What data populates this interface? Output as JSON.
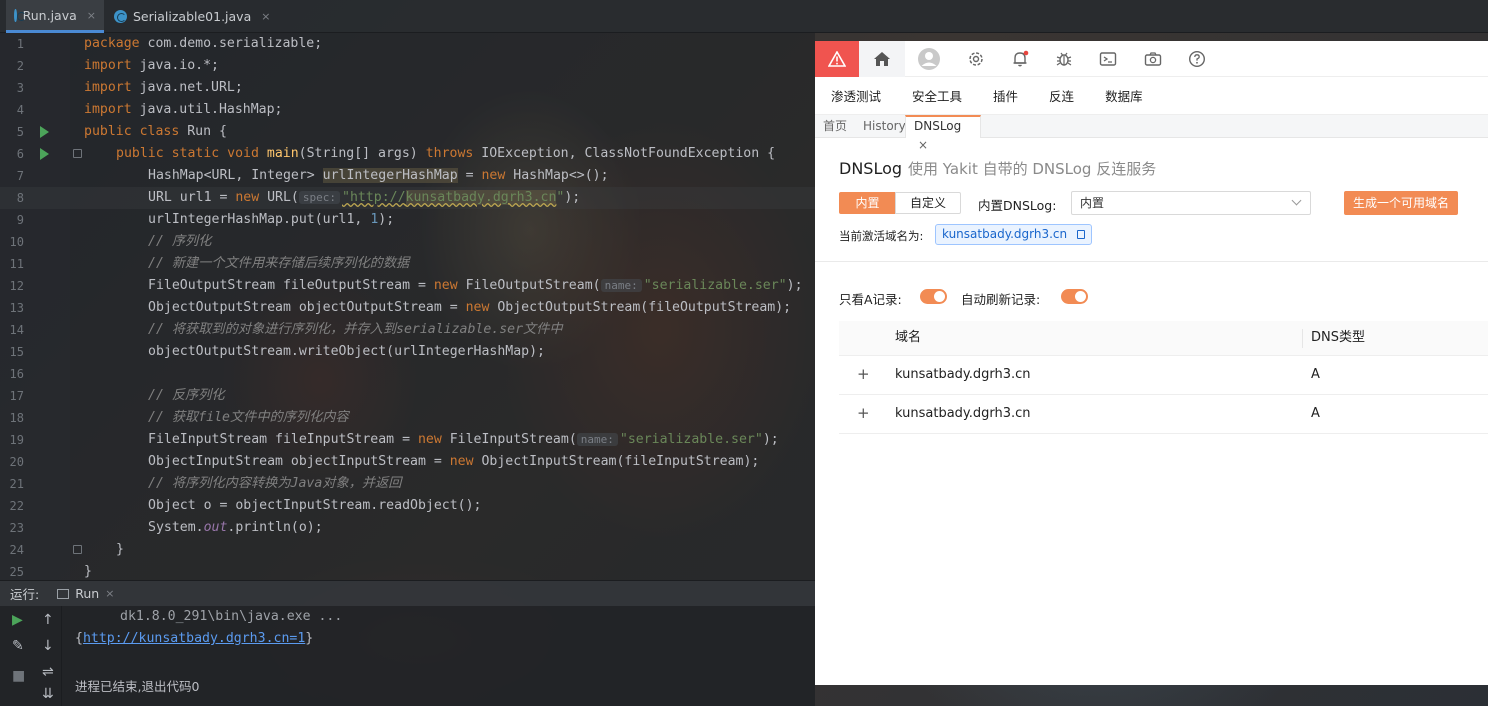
{
  "editor_tabs": [
    {
      "label": "Run.java",
      "close": "×"
    },
    {
      "label": "Serializable01.java",
      "close": "×"
    }
  ],
  "code_lines": [
    "1",
    "2",
    "3",
    "4",
    "5",
    "6",
    "7",
    "8",
    "9",
    "10",
    "11",
    "12",
    "13",
    "14",
    "15",
    "16",
    "17",
    "18",
    "19",
    "20",
    "21",
    "22",
    "23",
    "24",
    "25"
  ],
  "code": {
    "l1_kw": "package",
    "l1_rest": " com.demo.serializable;",
    "l2_kw": "import",
    "l2_rest": " java.io.*;",
    "l3_kw": "import",
    "l3_rest": " java.net.URL;",
    "l4_kw": "import",
    "l4_rest": " java.util.HashMap;",
    "l5_kw": "public class",
    "l5_rest": " Run {",
    "l6_kw": "public static void",
    "l6_fn": "main",
    "l6_a": "(String[] args) ",
    "l6_kw2": "throws",
    "l6_b": " IOException, ClassNotFoundException {",
    "l7_a": "HashMap<URL, Integer> ",
    "l7_var": "urlIntegerHashMap",
    "l7_b": " = ",
    "l7_kw": "new",
    "l7_c": " HashMap<>();",
    "l8_a": "URL url1 = ",
    "l8_kw": "new",
    "l8_b": " URL(",
    "l8_hint": "spec:",
    "l8_str_a": "\"http://",
    "l8_str_b": "kunsatbady.dgrh3.cn",
    "l8_str_c": "\"",
    "l8_c": ");",
    "l9_a": "urlIntegerHashMap.put(url1, ",
    "l9_num": "1",
    "l9_b": ");",
    "l10": "// 序列化",
    "l11": "// 新建一个文件用来存储后续序列化的数据",
    "l12_a": "FileOutputStream fileOutputStream = ",
    "l12_kw": "new",
    "l12_b": " FileOutputStream(",
    "l12_hint": "name:",
    "l12_str": "\"serializable.ser\"",
    "l12_c": ");",
    "l13_a": "ObjectOutputStream objectOutputStream = ",
    "l13_kw": "new",
    "l13_b": " ObjectOutputStream(fileOutputStream);",
    "l14": "// 将获取到的对象进行序列化，并存入到serializable.ser文件中",
    "l15": "objectOutputStream.writeObject(urlIntegerHashMap);",
    "l17": "// 反序列化",
    "l18": "// 获取file文件中的序列化内容",
    "l19_a": "FileInputStream fileInputStream = ",
    "l19_kw": "new",
    "l19_b": " FileInputStream(",
    "l19_hint": "name:",
    "l19_str": "\"serializable.ser\"",
    "l19_c": ");",
    "l20_a": "ObjectInputStream objectInputStream = ",
    "l20_kw": "new",
    "l20_b": " ObjectInputStream(fileInputStream);",
    "l21": "// 将序列化内容转换为Java对象，并返回",
    "l22": "Object o = objectInputStream.readObject();",
    "l23_a": "System.",
    "l23_st": "out",
    "l23_b": ".println(o);",
    "l24": "}",
    "l25": "}"
  },
  "run_panel": {
    "label": "运行:",
    "tab": "Run",
    "tab_close": "×",
    "cmd": "dk1.8.0_291\\bin\\java.exe ...",
    "out_open": "{",
    "out_link": "http://kunsatbady.dgrh3.cn=1",
    "out_close": "}",
    "exit": "进程已结束,退出代码0"
  },
  "yakit": {
    "menu": [
      "渗透测试",
      "安全工具",
      "插件",
      "反连",
      "数据库"
    ],
    "tabs": {
      "home": "首页",
      "history": "History",
      "dnslog": "DNSLog",
      "close": "×"
    },
    "title": "DNSLog",
    "subtitle": "使用 Yakit 自带的 DNSLog 反连服务",
    "seg_builtin": "内置",
    "seg_custom": "自定义",
    "dnslog_label": "内置DNSLog:",
    "dnslog_value": "内置",
    "generate_button": "生成一个可用域名",
    "active_label": "当前激活域名为:",
    "active_domain": "kunsatbady.dgrh3.cn",
    "only_a_label": "只看A记录:",
    "auto_refresh_label": "自动刷新记录:",
    "col_domain": "域名",
    "col_type": "DNS类型",
    "rows": [
      {
        "expand": "+",
        "domain": "kunsatbady.dgrh3.cn",
        "type": "A"
      },
      {
        "expand": "+",
        "domain": "kunsatbady.dgrh3.cn",
        "type": "A"
      }
    ],
    "toggles": {
      "only_a": true,
      "auto_refresh": true
    },
    "accent": "#f28b54",
    "alert_color": "#f0544f"
  }
}
